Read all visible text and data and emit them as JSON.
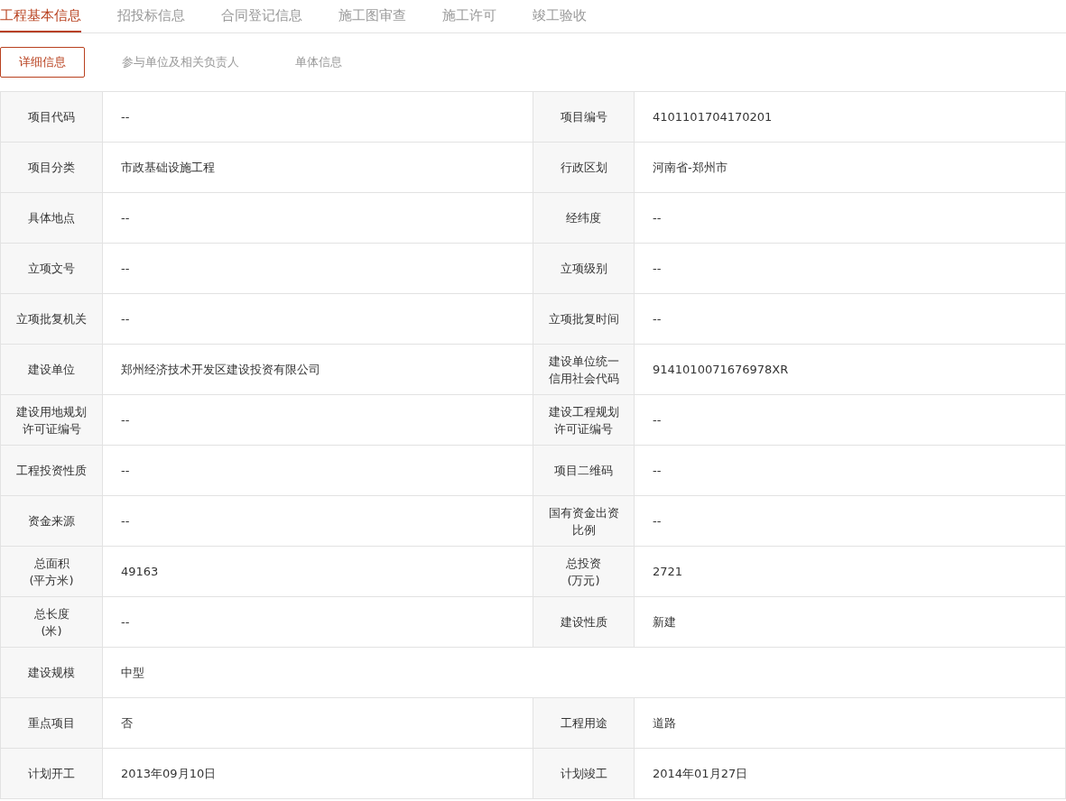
{
  "tabs": [
    {
      "label": "工程基本信息",
      "selected": true
    },
    {
      "label": "招投标信息",
      "selected": false
    },
    {
      "label": "合同登记信息",
      "selected": false
    },
    {
      "label": "施工图审查",
      "selected": false
    },
    {
      "label": "施工许可",
      "selected": false
    },
    {
      "label": "竣工验收",
      "selected": false
    }
  ],
  "subtabs": [
    {
      "label": "详细信息",
      "selected": true
    },
    {
      "label": "参与单位及相关负责人",
      "selected": false
    },
    {
      "label": "单体信息",
      "selected": false
    }
  ],
  "rows": [
    {
      "kind": "pair",
      "cells": [
        {
          "label": "项目代码",
          "value": "--"
        },
        {
          "label": "项目编号",
          "value": "4101101704170201"
        }
      ]
    },
    {
      "kind": "pair",
      "cells": [
        {
          "label": "项目分类",
          "value": "市政基础设施工程"
        },
        {
          "label": "行政区划",
          "value": "河南省-郑州市"
        }
      ]
    },
    {
      "kind": "pair",
      "cells": [
        {
          "label": "具体地点",
          "value": "--"
        },
        {
          "label": "经纬度",
          "value": "--"
        }
      ]
    },
    {
      "kind": "pair",
      "cells": [
        {
          "label": "立项文号",
          "value": "--"
        },
        {
          "label": "立项级别",
          "value": "--"
        }
      ]
    },
    {
      "kind": "pair",
      "cells": [
        {
          "label": "立项批复机关",
          "value": "--"
        },
        {
          "label": "立项批复时间",
          "value": "--"
        }
      ]
    },
    {
      "kind": "pair",
      "cells": [
        {
          "label": "建设单位",
          "value": "郑州经济技术开发区建设投资有限公司"
        },
        {
          "label": "建设单位统一信用社会代码",
          "value": "9141010071676978XR"
        }
      ]
    },
    {
      "kind": "pair",
      "cells": [
        {
          "label": "建设用地规划许可证编号",
          "value": "--"
        },
        {
          "label": "建设工程规划许可证编号",
          "value": "--"
        }
      ]
    },
    {
      "kind": "pair",
      "cells": [
        {
          "label": "工程投资性质",
          "value": "--"
        },
        {
          "label": "项目二维码",
          "value": "--"
        }
      ]
    },
    {
      "kind": "pair",
      "cells": [
        {
          "label": "资金来源",
          "value": "--"
        },
        {
          "label": "国有资金出资比例",
          "value": "--"
        }
      ]
    },
    {
      "kind": "pair",
      "cells": [
        {
          "label": "总面积\n(平方米)",
          "value": "49163"
        },
        {
          "label": "总投资\n(万元)",
          "value": "2721"
        }
      ]
    },
    {
      "kind": "pair",
      "cells": [
        {
          "label": "总长度\n(米)",
          "value": "--"
        },
        {
          "label": "建设性质",
          "value": "新建"
        }
      ]
    },
    {
      "kind": "wide",
      "cells": [
        {
          "label": "建设规模",
          "value": "中型"
        }
      ]
    },
    {
      "kind": "pair",
      "cells": [
        {
          "label": "重点项目",
          "value": "否"
        },
        {
          "label": "工程用途",
          "value": "道路"
        }
      ]
    },
    {
      "kind": "pair",
      "cells": [
        {
          "label": "计划开工",
          "value": "2013年09月10日"
        },
        {
          "label": "计划竣工",
          "value": "2014年01月27日"
        }
      ]
    }
  ]
}
